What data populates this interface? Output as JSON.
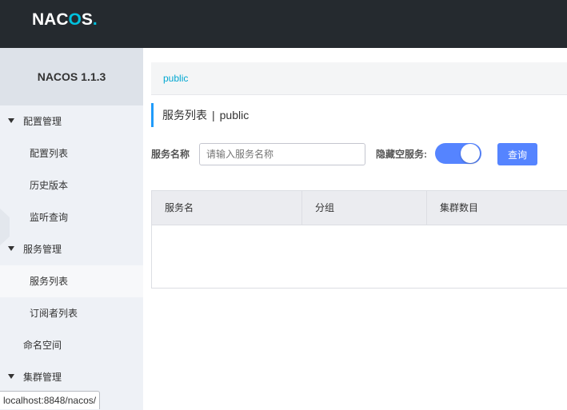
{
  "app": {
    "logo_text": "NAC",
    "logo_o": "O",
    "logo_tail": "S",
    "logo_dot": ".",
    "accent_color": "#5584ff",
    "link_color": "#00a7d1"
  },
  "sidebar": {
    "version": "NACOS 1.1.3",
    "items": [
      {
        "label": "配置管理",
        "type": "group",
        "icon": "caret-down-icon"
      },
      {
        "label": "配置列表",
        "type": "sub"
      },
      {
        "label": "历史版本",
        "type": "sub"
      },
      {
        "label": "监听查询",
        "type": "sub"
      },
      {
        "label": "服务管理",
        "type": "group",
        "icon": "caret-down-icon"
      },
      {
        "label": "服务列表",
        "type": "sub",
        "active": true
      },
      {
        "label": "订阅者列表",
        "type": "sub"
      },
      {
        "label": "命名空间",
        "type": "plain"
      },
      {
        "label": "集群管理",
        "type": "group",
        "icon": "caret-down-icon"
      }
    ]
  },
  "namespace_bar": {
    "current": "public"
  },
  "page": {
    "title": "服务列表",
    "separator": "|",
    "namespace": "public"
  },
  "filter": {
    "service_name_label": "服务名称",
    "service_name_placeholder": "请输入服务名称",
    "service_name_value": "",
    "hide_empty_label": "隐藏空服务:",
    "hide_empty_enabled": true,
    "query_button": "查询"
  },
  "table": {
    "columns": [
      "服务名",
      "分组",
      "集群数目"
    ],
    "rows": []
  },
  "status_bar": {
    "url": "localhost:8848/nacos/"
  }
}
